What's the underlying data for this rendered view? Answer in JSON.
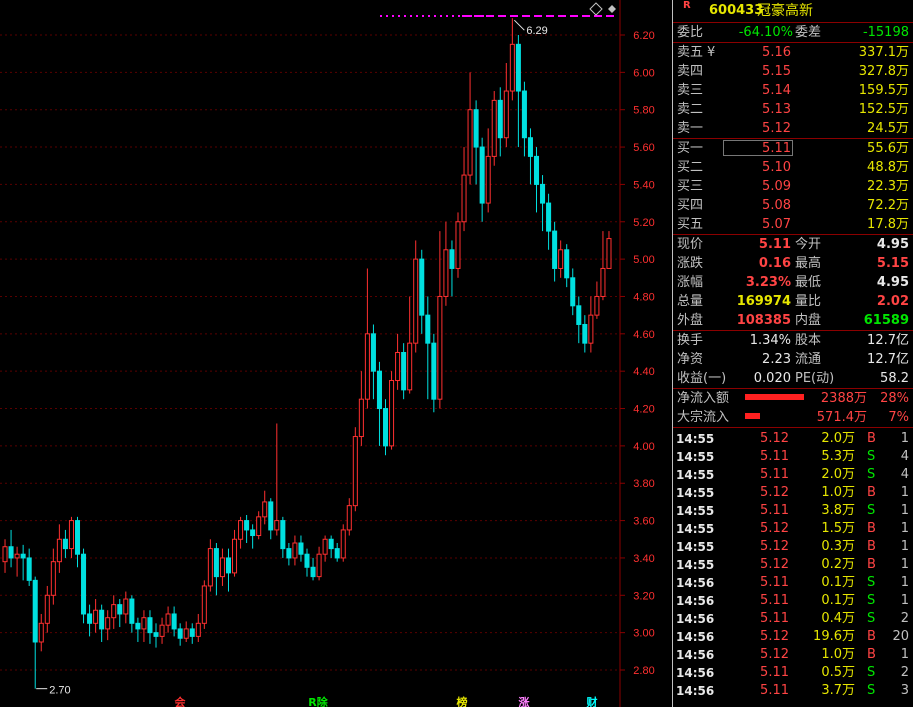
{
  "ticker": {
    "badge": "R",
    "code": "600433",
    "name": "冠豪高新"
  },
  "axis": {
    "ticks": [
      "6.20",
      "6.00",
      "5.80",
      "5.60",
      "5.40",
      "5.20",
      "5.00",
      "4.80",
      "4.60",
      "4.40",
      "4.20",
      "4.00",
      "3.80",
      "3.60",
      "3.40",
      "3.20",
      "3.00",
      "2.80"
    ],
    "high_label": "6.29",
    "low_label": "2.70",
    "diamond_icon": "diamond-outline-icon",
    "bottom_markers": [
      {
        "text": "会",
        "color": "#ff3030"
      },
      {
        "text": "R除",
        "color": "#00e600"
      },
      {
        "text": "榜",
        "color": "#e6e600"
      },
      {
        "text": "涨",
        "color": "#ff80ff"
      },
      {
        "text": "财",
        "color": "#00ffff"
      }
    ]
  },
  "chart_data": {
    "type": "candlestick",
    "y_axis_ticks": [
      6.2,
      6.0,
      5.8,
      5.6,
      5.4,
      5.2,
      5.0,
      4.8,
      4.6,
      4.4,
      4.2,
      4.0,
      3.8,
      3.6,
      3.4,
      3.2,
      3.0,
      2.8
    ],
    "ylim": [
      2.7,
      6.3
    ],
    "high": 6.29,
    "low": 2.7,
    "colors": {
      "up": "#ff3030",
      "down": "#00e0e0"
    },
    "candles": [
      [
        3.38,
        3.46,
        3.5,
        3.32
      ],
      [
        3.46,
        3.4,
        3.55,
        3.35
      ],
      [
        3.4,
        3.42,
        3.46,
        3.3
      ],
      [
        3.42,
        3.4,
        3.47,
        3.28
      ],
      [
        3.4,
        3.28,
        3.45,
        3.25
      ],
      [
        3.28,
        2.95,
        3.3,
        2.7
      ],
      [
        2.95,
        3.05,
        3.1,
        2.9
      ],
      [
        3.05,
        3.2,
        3.25,
        3.0
      ],
      [
        3.2,
        3.38,
        3.45,
        3.15
      ],
      [
        3.38,
        3.5,
        3.58,
        3.32
      ],
      [
        3.5,
        3.45,
        3.55,
        3.4
      ],
      [
        3.45,
        3.6,
        3.62,
        3.4
      ],
      [
        3.6,
        3.42,
        3.62,
        3.35
      ],
      [
        3.42,
        3.1,
        3.45,
        3.05
      ],
      [
        3.1,
        3.05,
        3.15,
        2.98
      ],
      [
        3.05,
        3.12,
        3.18,
        3.0
      ],
      [
        3.12,
        3.02,
        3.15,
        2.95
      ],
      [
        3.02,
        3.08,
        3.12,
        2.96
      ],
      [
        3.08,
        3.15,
        3.2,
        3.02
      ],
      [
        3.15,
        3.1,
        3.18,
        3.03
      ],
      [
        3.1,
        3.18,
        3.22,
        3.05
      ],
      [
        3.18,
        3.05,
        3.2,
        3.0
      ],
      [
        3.05,
        3.02,
        3.08,
        2.95
      ],
      [
        3.02,
        3.08,
        3.12,
        2.95
      ],
      [
        3.08,
        3.0,
        3.12,
        2.94
      ],
      [
        3.0,
        2.98,
        3.05,
        2.92
      ],
      [
        2.98,
        3.04,
        3.08,
        2.94
      ],
      [
        3.04,
        3.1,
        3.14,
        3.0
      ],
      [
        3.1,
        3.02,
        3.14,
        2.98
      ],
      [
        3.02,
        2.97,
        3.05,
        2.93
      ],
      [
        2.97,
        3.02,
        3.06,
        2.95
      ],
      [
        3.02,
        2.98,
        3.05,
        2.94
      ],
      [
        2.98,
        3.05,
        3.1,
        2.95
      ],
      [
        3.05,
        3.25,
        3.28,
        3.02
      ],
      [
        3.25,
        3.45,
        3.5,
        3.22
      ],
      [
        3.45,
        3.3,
        3.48,
        3.2
      ],
      [
        3.3,
        3.4,
        3.45,
        3.25
      ],
      [
        3.4,
        3.32,
        3.45,
        3.22
      ],
      [
        3.32,
        3.5,
        3.55,
        3.3
      ],
      [
        3.5,
        3.6,
        3.62,
        3.45
      ],
      [
        3.6,
        3.55,
        3.63,
        3.48
      ],
      [
        3.55,
        3.52,
        3.58,
        3.45
      ],
      [
        3.52,
        3.62,
        3.65,
        3.5
      ],
      [
        3.62,
        3.7,
        3.76,
        3.58
      ],
      [
        3.7,
        3.55,
        3.72,
        3.5
      ],
      [
        3.55,
        3.6,
        4.12,
        3.52
      ],
      [
        3.6,
        3.45,
        3.62,
        3.4
      ],
      [
        3.45,
        3.4,
        3.48,
        3.36
      ],
      [
        3.4,
        3.48,
        3.52,
        3.36
      ],
      [
        3.48,
        3.42,
        3.52,
        3.38
      ],
      [
        3.42,
        3.35,
        3.45,
        3.3
      ],
      [
        3.35,
        3.3,
        3.4,
        3.28
      ],
      [
        3.3,
        3.42,
        3.46,
        3.28
      ],
      [
        3.42,
        3.5,
        3.52,
        3.38
      ],
      [
        3.5,
        3.45,
        3.52,
        3.4
      ],
      [
        3.45,
        3.4,
        3.48,
        3.38
      ],
      [
        3.4,
        3.55,
        3.58,
        3.38
      ],
      [
        3.55,
        3.68,
        3.72,
        3.52
      ],
      [
        3.68,
        4.05,
        4.1,
        3.65
      ],
      [
        4.05,
        4.25,
        4.4,
        4.0
      ],
      [
        4.25,
        4.6,
        4.95,
        4.2
      ],
      [
        4.6,
        4.4,
        4.65,
        4.25
      ],
      [
        4.4,
        4.2,
        4.45,
        4.0
      ],
      [
        4.2,
        4.0,
        4.25,
        3.95
      ],
      [
        4.0,
        4.35,
        4.4,
        3.98
      ],
      [
        4.35,
        4.5,
        4.6,
        4.3
      ],
      [
        4.5,
        4.3,
        4.55,
        4.25
      ],
      [
        4.3,
        4.55,
        4.8,
        4.28
      ],
      [
        4.55,
        5.0,
        5.1,
        4.5
      ],
      [
        5.0,
        4.7,
        5.05,
        4.6
      ],
      [
        4.7,
        4.55,
        4.8,
        4.25
      ],
      [
        4.55,
        4.25,
        4.6,
        4.18
      ],
      [
        4.25,
        4.8,
        5.15,
        4.2
      ],
      [
        4.8,
        5.05,
        5.2,
        4.75
      ],
      [
        5.05,
        4.95,
        5.1,
        4.8
      ],
      [
        4.95,
        5.2,
        5.25,
        4.9
      ],
      [
        5.2,
        5.45,
        5.6,
        5.15
      ],
      [
        5.45,
        5.8,
        6.0,
        5.4
      ],
      [
        5.8,
        5.6,
        5.85,
        5.4
      ],
      [
        5.6,
        5.3,
        5.65,
        5.2
      ],
      [
        5.3,
        5.55,
        5.7,
        5.25
      ],
      [
        5.55,
        5.85,
        5.9,
        5.5
      ],
      [
        5.85,
        5.65,
        5.92,
        5.55
      ],
      [
        5.65,
        5.9,
        6.05,
        5.6
      ],
      [
        5.9,
        6.15,
        6.29,
        5.85
      ],
      [
        6.15,
        5.9,
        6.2,
        5.6
      ],
      [
        5.9,
        5.65,
        5.95,
        5.55
      ],
      [
        5.65,
        5.55,
        5.7,
        5.4
      ],
      [
        5.55,
        5.4,
        5.6,
        5.25
      ],
      [
        5.4,
        5.3,
        5.45,
        5.15
      ],
      [
        5.3,
        5.15,
        5.35,
        5.05
      ],
      [
        5.15,
        4.95,
        5.2,
        4.88
      ],
      [
        4.95,
        5.05,
        5.1,
        4.9
      ],
      [
        5.05,
        4.9,
        5.08,
        4.85
      ],
      [
        4.9,
        4.75,
        4.95,
        4.7
      ],
      [
        4.75,
        4.65,
        4.8,
        4.55
      ],
      [
        4.65,
        4.55,
        4.7,
        4.5
      ],
      [
        4.55,
        4.7,
        4.8,
        4.5
      ],
      [
        4.7,
        4.8,
        4.88,
        4.68
      ],
      [
        4.8,
        4.95,
        5.15,
        4.78
      ],
      [
        4.95,
        5.11,
        5.15,
        4.95
      ]
    ]
  },
  "quote": {
    "weibi_label": "委比",
    "weibi": "-64.10%",
    "weicha_label": "委差",
    "weicha": "-15198",
    "asks": [
      {
        "label": "卖五",
        "extra": "¥",
        "price": "5.16",
        "vol": "337.1万"
      },
      {
        "label": "卖四",
        "extra": "",
        "price": "5.15",
        "vol": "327.8万"
      },
      {
        "label": "卖三",
        "extra": "",
        "price": "5.14",
        "vol": "159.5万"
      },
      {
        "label": "卖二",
        "extra": "",
        "price": "5.13",
        "vol": "152.5万"
      },
      {
        "label": "卖一",
        "extra": "",
        "price": "5.12",
        "vol": "24.5万"
      }
    ],
    "bids": [
      {
        "label": "买一",
        "price": "5.11",
        "vol": "55.6万"
      },
      {
        "label": "买二",
        "price": "5.10",
        "vol": "48.8万"
      },
      {
        "label": "买三",
        "price": "5.09",
        "vol": "22.3万"
      },
      {
        "label": "买四",
        "price": "5.08",
        "vol": "72.2万"
      },
      {
        "label": "买五",
        "price": "5.07",
        "vol": "17.8万"
      }
    ],
    "stats": [
      {
        "l1": "现价",
        "v1": "5.11",
        "c1": "c-red",
        "l2": "今开",
        "v2": "4.95",
        "c2": "c-white"
      },
      {
        "l1": "涨跌",
        "v1": "0.16",
        "c1": "c-red",
        "l2": "最高",
        "v2": "5.15",
        "c2": "c-red"
      },
      {
        "l1": "涨幅",
        "v1": "3.23%",
        "c1": "c-red",
        "l2": "最低",
        "v2": "4.95",
        "c2": "c-white"
      },
      {
        "l1": "总量",
        "v1": "169974",
        "c1": "c-yellow",
        "l2": "量比",
        "v2": "2.02",
        "c2": "c-red"
      },
      {
        "l1": "外盘",
        "v1": "108385",
        "c1": "c-red",
        "l2": "内盘",
        "v2": "61589",
        "c2": "c-green"
      }
    ],
    "stats2": [
      {
        "l1": "换手",
        "v1": "1.34%",
        "l2": "股本",
        "v2": "12.7亿"
      },
      {
        "l1": "净资",
        "v1": "2.23",
        "l2": "流通",
        "v2": "12.7亿"
      },
      {
        "l1": "收益(一)",
        "v1": "0.020",
        "l2": "PE(动)",
        "v2": "58.2"
      }
    ],
    "flows": [
      {
        "label": "净流入额",
        "value": "2388万",
        "pct": "28%",
        "fill": 0.28
      },
      {
        "label": "大宗流入",
        "value": "571.4万",
        "pct": "7%",
        "fill": 0.07
      }
    ]
  },
  "trades": [
    {
      "t": "14:55",
      "p": "5.12",
      "v": "2.0万",
      "s": "B",
      "n": "1"
    },
    {
      "t": "14:55",
      "p": "5.11",
      "v": "5.3万",
      "s": "S",
      "n": "4"
    },
    {
      "t": "14:55",
      "p": "5.11",
      "v": "2.0万",
      "s": "S",
      "n": "4"
    },
    {
      "t": "14:55",
      "p": "5.12",
      "v": "1.0万",
      "s": "B",
      "n": "1"
    },
    {
      "t": "14:55",
      "p": "5.11",
      "v": "3.8万",
      "s": "S",
      "n": "1"
    },
    {
      "t": "14:55",
      "p": "5.12",
      "v": "1.5万",
      "s": "B",
      "n": "1"
    },
    {
      "t": "14:55",
      "p": "5.12",
      "v": "0.3万",
      "s": "B",
      "n": "1"
    },
    {
      "t": "14:55",
      "p": "5.12",
      "v": "0.2万",
      "s": "B",
      "n": "1"
    },
    {
      "t": "14:56",
      "p": "5.11",
      "v": "0.1万",
      "s": "S",
      "n": "1"
    },
    {
      "t": "14:56",
      "p": "5.11",
      "v": "0.1万",
      "s": "S",
      "n": "1"
    },
    {
      "t": "14:56",
      "p": "5.11",
      "v": "0.4万",
      "s": "S",
      "n": "2"
    },
    {
      "t": "14:56",
      "p": "5.12",
      "v": "19.6万",
      "s": "B",
      "n": "20"
    },
    {
      "t": "14:56",
      "p": "5.12",
      "v": "1.0万",
      "s": "B",
      "n": "1"
    },
    {
      "t": "14:56",
      "p": "5.11",
      "v": "0.5万",
      "s": "S",
      "n": "2"
    },
    {
      "t": "14:56",
      "p": "5.11",
      "v": "3.7万",
      "s": "S",
      "n": "3"
    }
  ]
}
